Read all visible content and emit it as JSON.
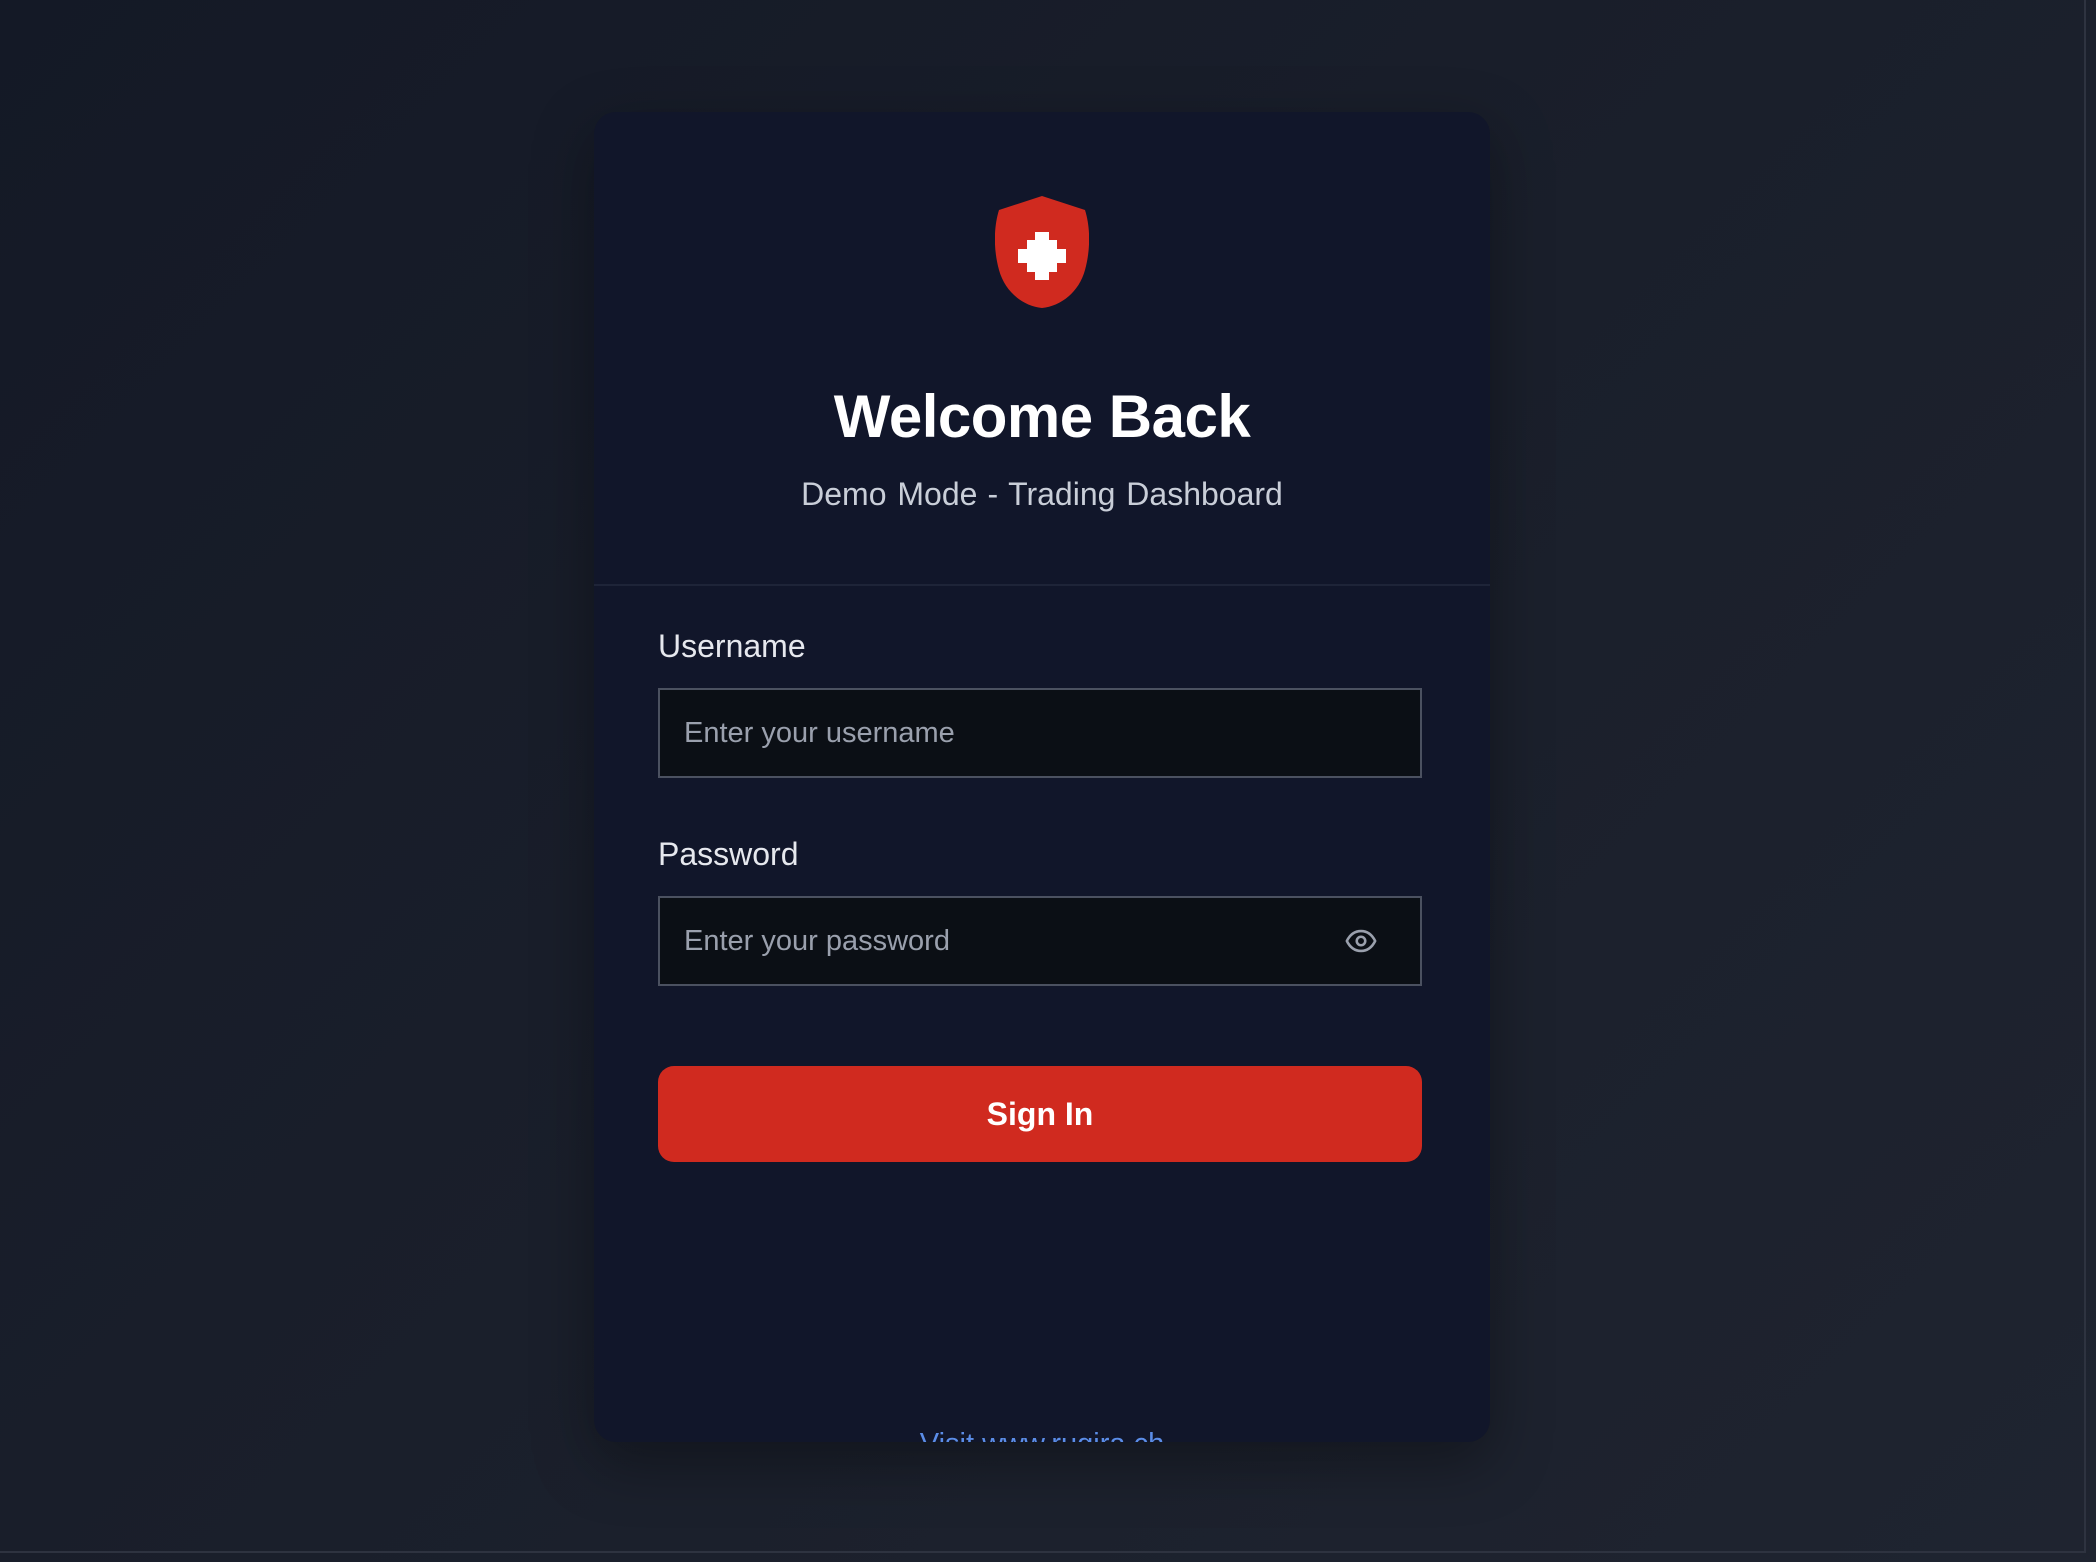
{
  "brand": {
    "logo_icon": "swiss-shield-icon",
    "accent_color": "#d02a1f"
  },
  "header": {
    "title": "Welcome Back",
    "subtitle_left": "Demo Mode",
    "subtitle_separator": "-",
    "subtitle_right": "Trading Dashboard"
  },
  "form": {
    "username": {
      "label": "Username",
      "placeholder": "Enter your username",
      "value": ""
    },
    "password": {
      "label": "Password",
      "placeholder": "Enter your password",
      "value": "",
      "toggle_icon": "eye-icon"
    },
    "submit_label": "Sign In"
  },
  "footer": {
    "link_text": "Visit www.rugira.ch",
    "link_color": "#5b8de8"
  }
}
